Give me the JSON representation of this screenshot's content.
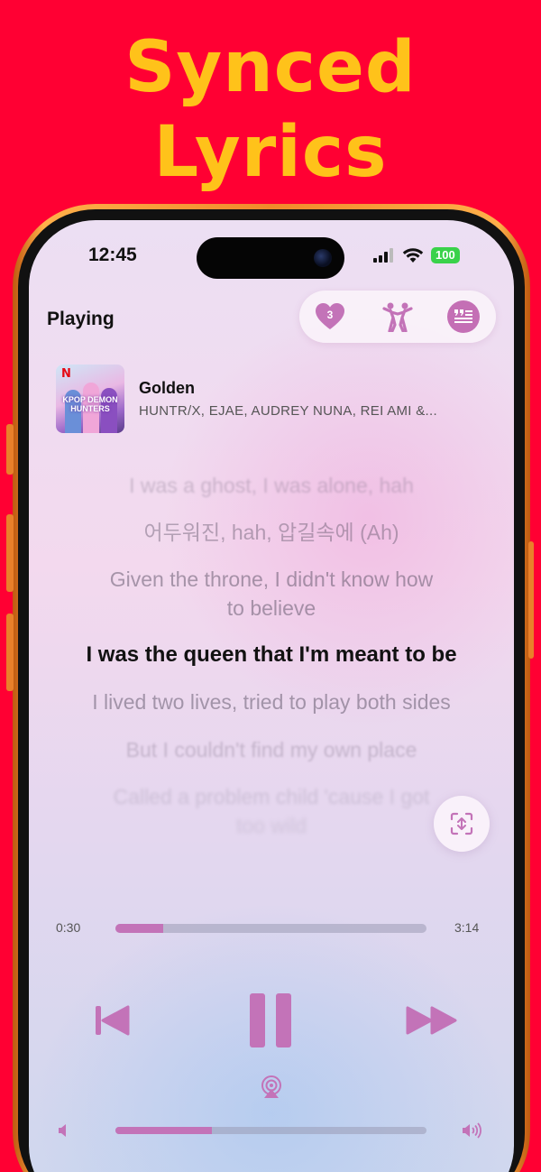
{
  "promo": {
    "headline_line1": "Synced",
    "headline_line2": "Lyrics"
  },
  "status_bar": {
    "time": "12:45",
    "battery": "100"
  },
  "header": {
    "title": "Playing",
    "favorites_count": "3"
  },
  "track": {
    "title": "Golden",
    "artist": "HUNTR/X, EJAE, AUDREY NUNA, REI AMI &...",
    "album_brand": "N",
    "album_text": "KPOP DEMON HUNTERS"
  },
  "lyrics": [
    {
      "text": "I was a ghost, I was alone, hah",
      "state": "past"
    },
    {
      "text": "어두워진, hah, 압길속에 (Ah)",
      "state": "past"
    },
    {
      "text": "Given the throne, I didn't know how",
      "state": "past"
    },
    {
      "text": "to believe",
      "state": "past"
    },
    {
      "text": "I was the queen that I'm meant to be",
      "state": "active"
    },
    {
      "text": "I lived two lives, tried to play both sides",
      "state": "upcoming"
    },
    {
      "text": "But I couldn't find my own place",
      "state": "upcoming"
    },
    {
      "text": "Called a problem child 'cause I got",
      "state": "upcoming"
    },
    {
      "text": "too wild",
      "state": "upcoming"
    }
  ],
  "playback": {
    "current_time": "0:30",
    "total_time": "3:14",
    "progress": 0.155,
    "volume": 0.31,
    "is_playing": true
  },
  "icons": {
    "favorites": "heart-icon",
    "dance": "dancing-couple-icon",
    "lyrics": "lyrics-quote-icon",
    "fullscreen": "expand-icon",
    "previous": "previous-track-icon",
    "pause": "pause-icon",
    "next": "next-track-icon",
    "airplay": "airplay-icon",
    "volume_low": "volume-low-icon",
    "volume_high": "volume-high-icon"
  },
  "colors": {
    "background": "#ff0033",
    "headline": "#ffc21a",
    "accent": "#c373b8",
    "battery": "#3ad24a"
  }
}
